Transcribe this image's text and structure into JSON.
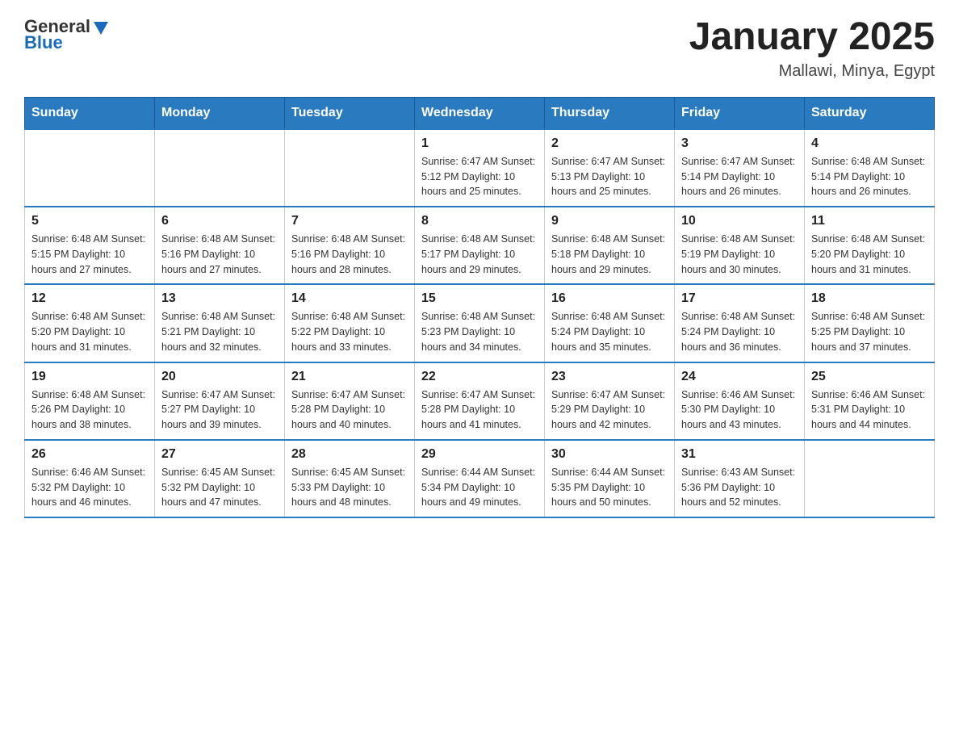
{
  "header": {
    "logo_general": "General",
    "logo_blue": "Blue",
    "title": "January 2025",
    "subtitle": "Mallawi, Minya, Egypt"
  },
  "weekdays": [
    "Sunday",
    "Monday",
    "Tuesday",
    "Wednesday",
    "Thursday",
    "Friday",
    "Saturday"
  ],
  "weeks": [
    [
      {
        "day": "",
        "info": ""
      },
      {
        "day": "",
        "info": ""
      },
      {
        "day": "",
        "info": ""
      },
      {
        "day": "1",
        "info": "Sunrise: 6:47 AM\nSunset: 5:12 PM\nDaylight: 10 hours\nand 25 minutes."
      },
      {
        "day": "2",
        "info": "Sunrise: 6:47 AM\nSunset: 5:13 PM\nDaylight: 10 hours\nand 25 minutes."
      },
      {
        "day": "3",
        "info": "Sunrise: 6:47 AM\nSunset: 5:14 PM\nDaylight: 10 hours\nand 26 minutes."
      },
      {
        "day": "4",
        "info": "Sunrise: 6:48 AM\nSunset: 5:14 PM\nDaylight: 10 hours\nand 26 minutes."
      }
    ],
    [
      {
        "day": "5",
        "info": "Sunrise: 6:48 AM\nSunset: 5:15 PM\nDaylight: 10 hours\nand 27 minutes."
      },
      {
        "day": "6",
        "info": "Sunrise: 6:48 AM\nSunset: 5:16 PM\nDaylight: 10 hours\nand 27 minutes."
      },
      {
        "day": "7",
        "info": "Sunrise: 6:48 AM\nSunset: 5:16 PM\nDaylight: 10 hours\nand 28 minutes."
      },
      {
        "day": "8",
        "info": "Sunrise: 6:48 AM\nSunset: 5:17 PM\nDaylight: 10 hours\nand 29 minutes."
      },
      {
        "day": "9",
        "info": "Sunrise: 6:48 AM\nSunset: 5:18 PM\nDaylight: 10 hours\nand 29 minutes."
      },
      {
        "day": "10",
        "info": "Sunrise: 6:48 AM\nSunset: 5:19 PM\nDaylight: 10 hours\nand 30 minutes."
      },
      {
        "day": "11",
        "info": "Sunrise: 6:48 AM\nSunset: 5:20 PM\nDaylight: 10 hours\nand 31 minutes."
      }
    ],
    [
      {
        "day": "12",
        "info": "Sunrise: 6:48 AM\nSunset: 5:20 PM\nDaylight: 10 hours\nand 31 minutes."
      },
      {
        "day": "13",
        "info": "Sunrise: 6:48 AM\nSunset: 5:21 PM\nDaylight: 10 hours\nand 32 minutes."
      },
      {
        "day": "14",
        "info": "Sunrise: 6:48 AM\nSunset: 5:22 PM\nDaylight: 10 hours\nand 33 minutes."
      },
      {
        "day": "15",
        "info": "Sunrise: 6:48 AM\nSunset: 5:23 PM\nDaylight: 10 hours\nand 34 minutes."
      },
      {
        "day": "16",
        "info": "Sunrise: 6:48 AM\nSunset: 5:24 PM\nDaylight: 10 hours\nand 35 minutes."
      },
      {
        "day": "17",
        "info": "Sunrise: 6:48 AM\nSunset: 5:24 PM\nDaylight: 10 hours\nand 36 minutes."
      },
      {
        "day": "18",
        "info": "Sunrise: 6:48 AM\nSunset: 5:25 PM\nDaylight: 10 hours\nand 37 minutes."
      }
    ],
    [
      {
        "day": "19",
        "info": "Sunrise: 6:48 AM\nSunset: 5:26 PM\nDaylight: 10 hours\nand 38 minutes."
      },
      {
        "day": "20",
        "info": "Sunrise: 6:47 AM\nSunset: 5:27 PM\nDaylight: 10 hours\nand 39 minutes."
      },
      {
        "day": "21",
        "info": "Sunrise: 6:47 AM\nSunset: 5:28 PM\nDaylight: 10 hours\nand 40 minutes."
      },
      {
        "day": "22",
        "info": "Sunrise: 6:47 AM\nSunset: 5:28 PM\nDaylight: 10 hours\nand 41 minutes."
      },
      {
        "day": "23",
        "info": "Sunrise: 6:47 AM\nSunset: 5:29 PM\nDaylight: 10 hours\nand 42 minutes."
      },
      {
        "day": "24",
        "info": "Sunrise: 6:46 AM\nSunset: 5:30 PM\nDaylight: 10 hours\nand 43 minutes."
      },
      {
        "day": "25",
        "info": "Sunrise: 6:46 AM\nSunset: 5:31 PM\nDaylight: 10 hours\nand 44 minutes."
      }
    ],
    [
      {
        "day": "26",
        "info": "Sunrise: 6:46 AM\nSunset: 5:32 PM\nDaylight: 10 hours\nand 46 minutes."
      },
      {
        "day": "27",
        "info": "Sunrise: 6:45 AM\nSunset: 5:32 PM\nDaylight: 10 hours\nand 47 minutes."
      },
      {
        "day": "28",
        "info": "Sunrise: 6:45 AM\nSunset: 5:33 PM\nDaylight: 10 hours\nand 48 minutes."
      },
      {
        "day": "29",
        "info": "Sunrise: 6:44 AM\nSunset: 5:34 PM\nDaylight: 10 hours\nand 49 minutes."
      },
      {
        "day": "30",
        "info": "Sunrise: 6:44 AM\nSunset: 5:35 PM\nDaylight: 10 hours\nand 50 minutes."
      },
      {
        "day": "31",
        "info": "Sunrise: 6:43 AM\nSunset: 5:36 PM\nDaylight: 10 hours\nand 52 minutes."
      },
      {
        "day": "",
        "info": ""
      }
    ]
  ]
}
